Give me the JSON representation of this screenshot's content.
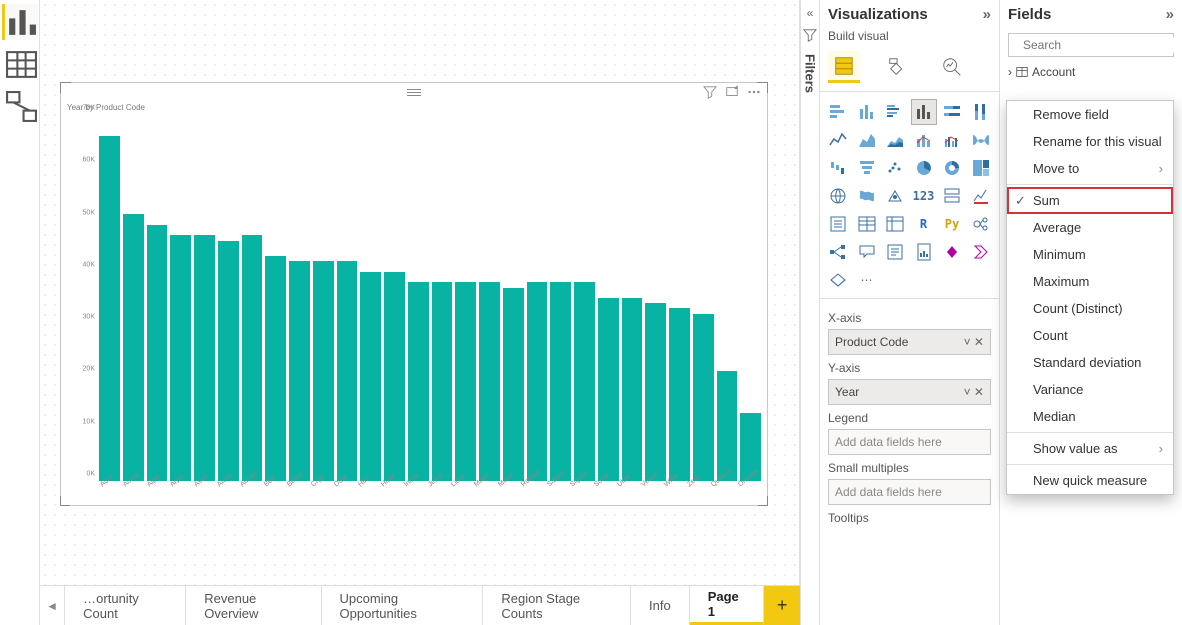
{
  "rail": {
    "views": [
      "report",
      "data",
      "model"
    ]
  },
  "filters_label": "Filters",
  "viz_pane": {
    "title": "Visualizations",
    "subtitle": "Build visual",
    "wells": {
      "xaxis": {
        "label": "X-axis",
        "value": "Product Code"
      },
      "yaxis": {
        "label": "Y-axis",
        "value": "Year"
      },
      "legend": {
        "label": "Legend",
        "placeholder": "Add data fields here"
      },
      "smallmult": {
        "label": "Small multiples",
        "placeholder": "Add data fields here"
      },
      "tooltips": {
        "label": "Tooltips"
      }
    }
  },
  "fields_pane": {
    "title": "Fields",
    "search_placeholder": "Search",
    "first_table": "Account"
  },
  "context_menu": {
    "remove": "Remove field",
    "rename": "Rename for this visual",
    "moveto": "Move to",
    "sum": "Sum",
    "avg": "Average",
    "min": "Minimum",
    "max": "Maximum",
    "countd": "Count (Distinct)",
    "count": "Count",
    "stdev": "Standard deviation",
    "variance": "Variance",
    "median": "Median",
    "showas": "Show value as",
    "quick": "New quick measure"
  },
  "tabs": {
    "t1": "…ortunity Count",
    "t2": "Revenue Overview",
    "t3": "Upcoming Opportunities",
    "t4": "Region Stage Counts",
    "t5": "Info",
    "t6": "Page 1"
  },
  "visual": {
    "title": "Year by Product Code"
  },
  "chart_data": {
    "type": "bar",
    "title": "Year by Product Code",
    "xlabel": "Product Code",
    "ylabel": "Year",
    "ylim": [
      0,
      70000
    ],
    "yticks": [
      "0K",
      "10K",
      "20K",
      "30K",
      "40K",
      "50K",
      "60K",
      "70K"
    ],
    "categories": [
      "Acer",
      "Acura",
      "Alpa",
      "Arpa",
      "Asus",
      "Atom",
      "Aurum",
      "Bell",
      "Bemo",
      "Crgo",
      "Data",
      "Hilo",
      "Hiser",
      "Incus",
      "Jesus",
      "Libra",
      "Mago",
      "Mesa",
      "Roman",
      "Saturn",
      "Sigma",
      "Sona",
      "Ultra",
      "Venus",
      "Wilm",
      "Zeta",
      "Quintus",
      "Omnius"
    ],
    "values": [
      66000,
      51000,
      49000,
      47000,
      47000,
      46000,
      47000,
      43000,
      42000,
      42000,
      42000,
      40000,
      40000,
      38000,
      38000,
      38000,
      38000,
      37000,
      38000,
      38000,
      38000,
      35000,
      35000,
      34000,
      33000,
      32000,
      21000,
      13000
    ]
  }
}
